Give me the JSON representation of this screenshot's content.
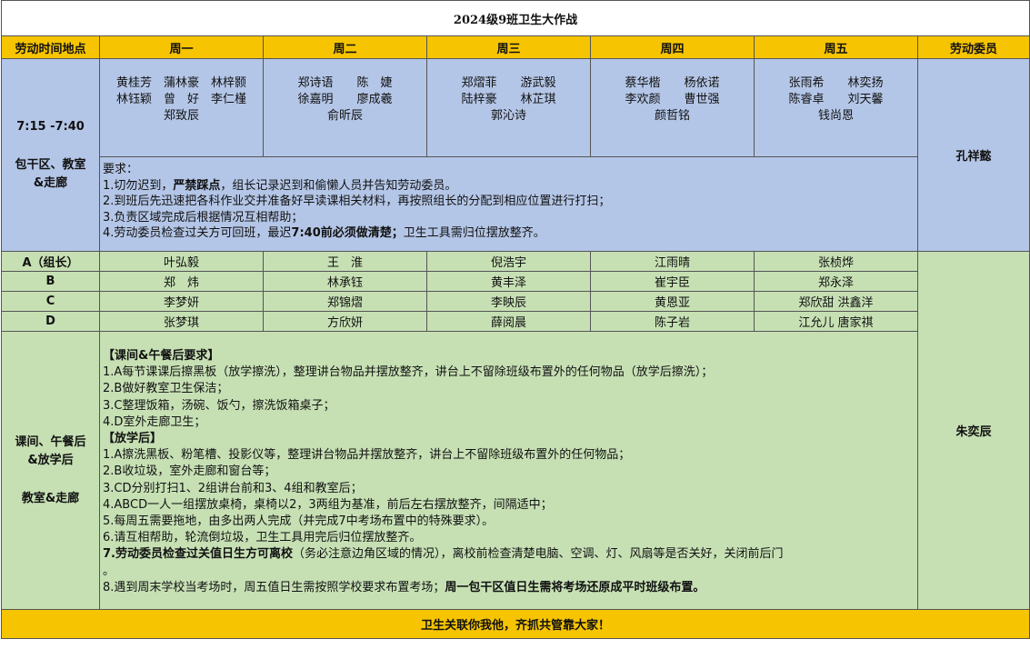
{
  "title": "2024级9班卫生大作战",
  "header": {
    "col0": "劳动时间地点",
    "days": [
      "周一",
      "周二",
      "周三",
      "周四",
      "周五"
    ],
    "member": "劳动委员"
  },
  "morning": {
    "time": "7:15 -7:40",
    "place_line1": "包干区、教室",
    "place_line2": "&走廊",
    "names": [
      [
        "黄桂芳　蒲林豪　林梓颢",
        "林钰颖　曾　好　李仁槿",
        "郑致辰"
      ],
      [
        "郑诗语　　陈　婕",
        "徐嘉明　　廖成羲",
        "俞昕辰"
      ],
      [
        "郑熠菲　　游武毅",
        "陆梓豪　　林芷琪",
        "郭沁诗"
      ],
      [
        "蔡华楷　　杨依诺",
        "李欢颜　　曹世强",
        "颜哲铭"
      ],
      [
        "张雨希　　林奕扬",
        "陈睿卓　　刘天馨",
        "钱尚恩"
      ]
    ],
    "req_title": "要求：",
    "req": {
      "r1_pre": "1.切勿迟到，",
      "r1_bold": "严禁踩点",
      "r1_post": "，组长记录迟到和偷懒人员并告知劳动委员。",
      "r2": "2.到班后先迅速把各科作业交并准备好早读课相关材料，再按照组长的分配到相应位置进行打扫；",
      "r3": "3.负责区域完成后根据情况互相帮助；",
      "r4_pre": "4.劳动委员检查过关方可回班，最迟",
      "r4_bold": "7:40前必须做清楚；",
      "r4_post": "卫生工具需归位摆放整齐。"
    },
    "member": "孔祥懿"
  },
  "groups": [
    {
      "label": "A（组长）",
      "cells": [
        "叶弘毅",
        "王　淮",
        "倪浩宇",
        "江雨晴",
        "张桢烨"
      ]
    },
    {
      "label": "B",
      "cells": [
        "郑　炜",
        "林承钰",
        "黄丰泽",
        "崔宇臣",
        "郑永泽"
      ]
    },
    {
      "label": "C",
      "cells": [
        "李梦妍",
        "郑锦熠",
        "李映辰",
        "黄恩亚",
        "郑欣甜 洪鑫洋"
      ]
    },
    {
      "label": "D",
      "cells": [
        "张梦琪",
        "方欣妍",
        "薛阅晨",
        "陈子岩",
        "江允儿 唐家祺"
      ]
    }
  ],
  "afternoon": {
    "line1": "课间、午餐后",
    "line2": "&放学后",
    "line3": "教室&走廊",
    "sec1_title": "【课间&午餐后要求】",
    "sec1": [
      "1.A每节课课后擦黑板（放学擦洗），整理讲台物品并摆放整齐，讲台上不留除班级布置外的任何物品（放学后擦洗）；",
      "2.B做好教室卫生保洁；",
      "3.C整理饭箱，汤碗、饭勺，擦洗饭箱桌子；",
      "4.D室外走廊卫生；"
    ],
    "sec2_title": "【放学后】",
    "sec2": [
      "1.A擦洗黑板、粉笔槽、投影仪等，整理讲台物品并摆放整齐，讲台上不留除班级布置外的任何物品；",
      "2.B收垃圾，室外走廊和窗台等；",
      "3.CD分别打扫1、2组讲台前和3、4组和教室后；",
      "4.ABCD一人一组摆放桌椅，桌椅以2，3两组为基准，前后左右摆放整齐，间隔适中；",
      "5.每周五需要拖地，由多出两人完成（并完成7中考场布置中的特殊要求）。",
      "6.请互相帮助，轮流倒垃圾，卫生工具用完后归位摆放整齐。"
    ],
    "s7_bold": "7.劳动委员检查过关值日生方可离校",
    "s7_rest": "（务必注意边角区域的情况），离校前检查清楚电脑、空调、灯、风扇等是否关好，关闭前后门",
    "s7_tail": "。",
    "s8_pre": "8.遇到周末学校当考场时，周五值日生需按照学校要求布置考场；",
    "s8_bold": "周一包干区值日生需将考场还原成平时班级布置。",
    "member": "朱奕辰"
  },
  "footer": "卫生关联你我他，齐抓共管靠大家！"
}
